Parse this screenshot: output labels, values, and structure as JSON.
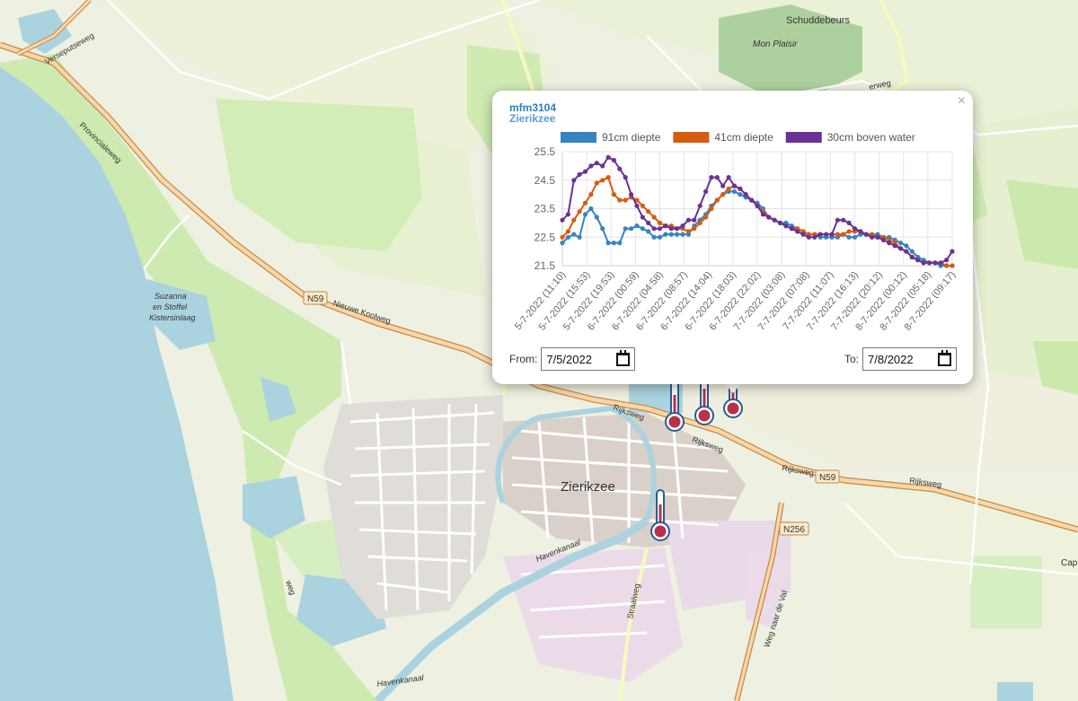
{
  "map": {
    "place_labels": {
      "schuddebeurs": "Schuddebeurs",
      "mon_plaisir": "Mon Plaisir",
      "zierikzee": "Zierikzee",
      "kistersinlaag_1": "Suzanna",
      "kistersinlaag_2": "en Stoffel",
      "kistersinlaag_3": "Kistersinlaag",
      "cap": "Cap"
    },
    "road_labels": {
      "verseputseweg": "Verseputseweg",
      "provincialeweg": "Provincialeweg",
      "nieuwe_koolweg": "Nieuwe Koolweg",
      "rijksweg_1": "Rijksweg",
      "rijksweg_2": "Rijksweg",
      "rijksweg_3": "Rijksweg",
      "rijksweg_4": "Rijksweg",
      "straalweg": "Straalweg",
      "weg_naar_de_val": "Weg naar de Val",
      "havenkanaal_1": "Havenkanaal",
      "havenkanaal_2": "Havenkanaal",
      "erweg": "erweg",
      "weg_top": "weg"
    },
    "route_shields": {
      "n59_west": "N59",
      "n59_east": "N59",
      "n256": "N256"
    },
    "colors": {
      "water": "#aad3df",
      "land": "#f2efe9",
      "grass": "#cdebb0",
      "meadow": "#def0c8",
      "urban": "#dcdcdc",
      "trunk": "#fcd6a4",
      "trunk_casing": "#c08b51"
    },
    "markers": [
      "thermometer-icon",
      "thermometer-icon",
      "thermometer-icon",
      "thermometer-icon"
    ]
  },
  "popup": {
    "station_id": "mfm3104",
    "station_name": "Zierikzee",
    "close_label": "×",
    "from_label": "From:",
    "from_value": "7/5/2022",
    "to_label": "To:",
    "to_value": "7/8/2022"
  },
  "chart_data": {
    "type": "line",
    "ylim": [
      21.5,
      25.5
    ],
    "yticks": [
      21.5,
      22.5,
      23.5,
      24.5,
      25.5
    ],
    "x_tick_labels": [
      "5-7-2022 (11:10)",
      "5-7-2022 (15:53)",
      "5-7-2022 (19:53)",
      "6-7-2022 (00:59)",
      "6-7-2022 (04:58)",
      "6-7-2022 (08:57)",
      "6-7-2022 (14:04)",
      "6-7-2022 (18:03)",
      "6-7-2022 (22:02)",
      "7-7-2022 (03:08)",
      "7-7-2022 (07:08)",
      "7-7-2022 (11:07)",
      "7-7-2022 (16:13)",
      "7-7-2022 (20:12)",
      "8-7-2022 (00:12)",
      "8-7-2022 (05:18)",
      "8-7-2022 (09:17)"
    ],
    "grid": true,
    "legend_position": "top",
    "series": [
      {
        "name": "91cm diepte",
        "color": "#3584c0",
        "values": [
          22.3,
          22.5,
          22.6,
          22.5,
          23.3,
          23.5,
          23.2,
          22.8,
          22.3,
          22.3,
          22.3,
          22.8,
          22.8,
          22.9,
          22.8,
          22.7,
          22.5,
          22.5,
          22.6,
          22.6,
          22.6,
          22.6,
          22.6,
          22.9,
          23.1,
          23.3,
          23.6,
          23.8,
          24.0,
          24.1,
          24.1,
          24.0,
          23.9,
          23.8,
          23.7,
          23.5,
          23.2,
          23.1,
          23.0,
          23.0,
          22.9,
          22.8,
          22.7,
          22.6,
          22.6,
          22.5,
          22.5,
          22.5,
          22.5,
          22.6,
          22.5,
          22.5,
          22.6,
          22.6,
          22.6,
          22.6,
          22.5,
          22.5,
          22.4,
          22.3,
          22.2,
          22.0,
          21.8,
          21.7,
          21.6,
          21.6,
          21.5,
          21.5,
          21.5
        ]
      },
      {
        "name": "41cm diepte",
        "color": "#d65c10",
        "values": [
          22.5,
          22.7,
          23.1,
          23.4,
          23.7,
          24.0,
          24.4,
          24.5,
          24.6,
          24.0,
          23.8,
          23.8,
          23.9,
          23.8,
          23.6,
          23.4,
          23.2,
          23.0,
          22.9,
          22.9,
          22.8,
          22.8,
          22.7,
          22.8,
          23.0,
          23.2,
          23.5,
          23.8,
          24.0,
          24.2,
          24.3,
          24.2,
          24.0,
          23.8,
          23.6,
          23.4,
          23.2,
          23.1,
          23.0,
          22.9,
          22.8,
          22.8,
          22.7,
          22.6,
          22.6,
          22.6,
          22.6,
          22.6,
          22.6,
          22.6,
          22.7,
          22.7,
          22.7,
          22.6,
          22.6,
          22.5,
          22.5,
          22.4,
          22.3,
          22.1,
          22.0,
          21.8,
          21.7,
          21.6,
          21.6,
          21.6,
          21.6,
          21.5,
          21.5
        ]
      },
      {
        "name": "30cm boven water",
        "color": "#6a3296",
        "values": [
          23.1,
          23.3,
          24.5,
          24.7,
          24.8,
          25.0,
          25.1,
          25.0,
          25.3,
          25.2,
          24.9,
          24.6,
          24.0,
          23.6,
          23.2,
          23.0,
          22.8,
          22.8,
          22.9,
          22.8,
          22.8,
          22.9,
          23.1,
          23.1,
          23.6,
          24.1,
          24.6,
          24.6,
          24.3,
          24.6,
          24.3,
          24.2,
          24.0,
          23.8,
          23.6,
          23.3,
          23.2,
          23.1,
          23.0,
          22.9,
          22.8,
          22.7,
          22.6,
          22.5,
          22.5,
          22.6,
          22.6,
          22.6,
          23.1,
          23.1,
          23.0,
          22.8,
          22.7,
          22.6,
          22.5,
          22.5,
          22.4,
          22.3,
          22.2,
          22.1,
          22.0,
          21.8,
          21.7,
          21.6,
          21.6,
          21.6,
          21.6,
          21.7,
          22.0
        ]
      }
    ]
  }
}
